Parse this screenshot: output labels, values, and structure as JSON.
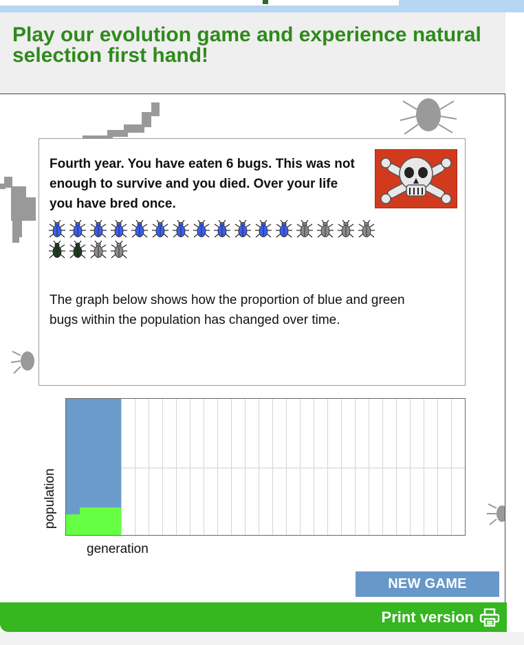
{
  "header": {
    "title": "Play our evolution game and experience natural selection first hand!"
  },
  "dialog": {
    "message": "Fourth year. You have eaten 6 bugs. This was not enough to survive and you died. Over your life you have bred once.",
    "bugs_row1": [
      "blue",
      "blue",
      "blue",
      "blue",
      "blue",
      "blue",
      "blue",
      "blue",
      "blue",
      "blue",
      "blue",
      "blue",
      "gray",
      "gray",
      "gray",
      "gray"
    ],
    "bugs_row2": [
      "green",
      "green",
      "gray",
      "gray"
    ],
    "explanation": "The graph below shows how the proportion of blue and green bugs within the population has changed over time.",
    "flag_icon": "skull-crossbones-icon"
  },
  "graph": {
    "ylabel": "population",
    "xlabel": "generation",
    "generation_count": 29,
    "generations_shown": [
      {
        "generation": 1,
        "green_fraction": 0.15
      },
      {
        "generation": 2,
        "green_fraction": 0.2
      },
      {
        "generation": 3,
        "green_fraction": 0.2
      },
      {
        "generation": 4,
        "green_fraction": 0.2
      }
    ],
    "colors": {
      "blue": "#6a9bca",
      "green": "#66ff44"
    }
  },
  "buttons": {
    "new_game": "NEW GAME"
  },
  "footer": {
    "print_label": "Print version",
    "print_icon": "printer-icon"
  },
  "colors": {
    "title_green": "#2f8a1c",
    "footer_green": "#36b620",
    "button_blue": "#6897c9",
    "flag_red": "#d23a1e"
  }
}
